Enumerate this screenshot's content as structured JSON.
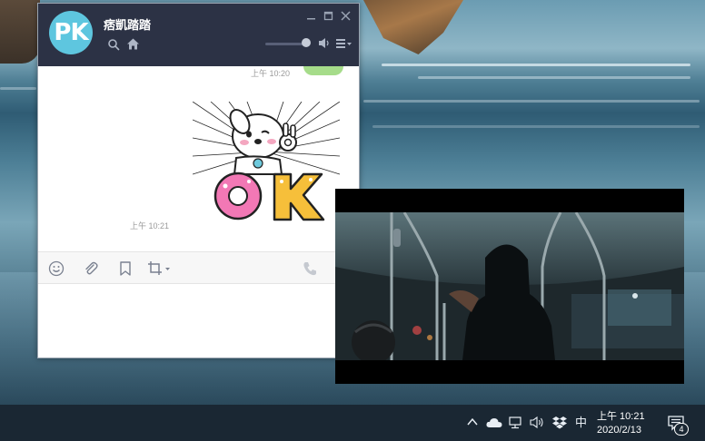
{
  "chat_window": {
    "avatar_text": "PK",
    "title": "痞凱踏踏",
    "messages": [
      {
        "time": "上午 10:20",
        "type": "text-bubble-partial"
      },
      {
        "time": "上午 10:21",
        "type": "sticker",
        "sticker_text": "OK"
      }
    ],
    "header_icons": [
      "search-icon",
      "home-icon",
      "speaker-icon",
      "menu-icon"
    ],
    "window_buttons": [
      "minimize-icon",
      "maximize-icon",
      "close-icon"
    ],
    "toolbar_icons": [
      "emoji-icon",
      "attach-icon",
      "bookmark-icon",
      "crop-icon",
      "phone-icon"
    ]
  },
  "taskbar": {
    "tray_icons": [
      "chevron-up-icon",
      "cloud-icon",
      "network-icon",
      "volume-icon",
      "dropbox-icon"
    ],
    "ime": "中",
    "time": "上午 10:21",
    "date": "2020/2/13",
    "notification_count": "4"
  },
  "colors": {
    "chat_header": "#2c3245",
    "avatar": "#5ec6df",
    "bubble_green": "#a6dc8a",
    "taskbar": "#1a2733"
  }
}
